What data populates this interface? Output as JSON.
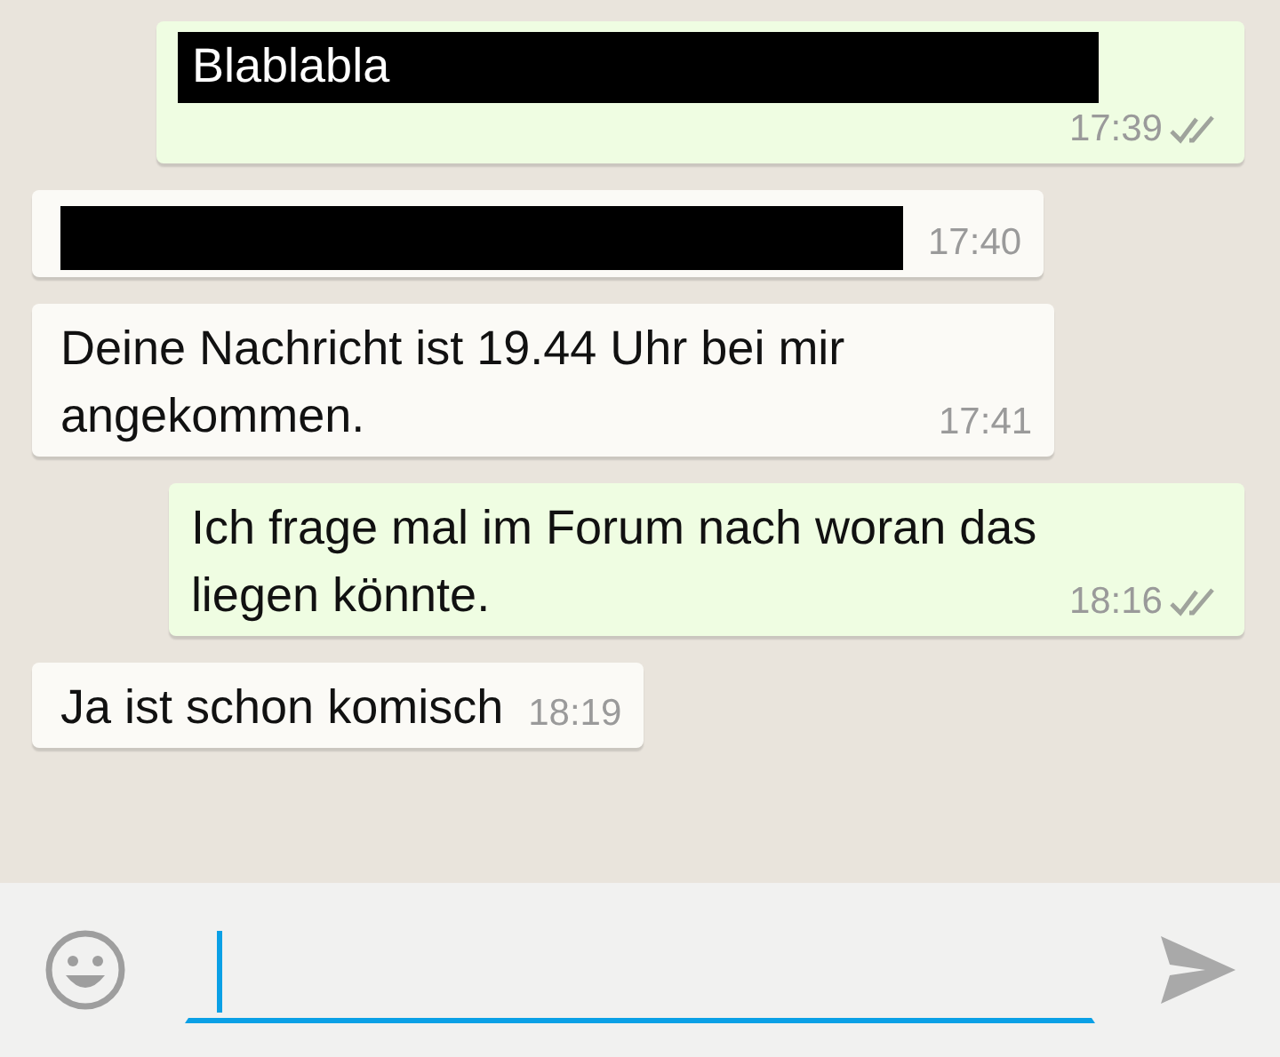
{
  "messages": [
    {
      "kind": "outgoing",
      "text": "Blablabla",
      "redacted": true,
      "time": "17:39"
    },
    {
      "kind": "incoming",
      "redacted": true,
      "time": "17:40"
    },
    {
      "kind": "incoming",
      "text": "Deine Nachricht ist 19.44 Uhr bei mir angekommen.",
      "redacted": false,
      "time": "17:41"
    },
    {
      "kind": "outgoing",
      "text": "Ich frage mal im Forum nach woran das liegen könnte.",
      "redacted": false,
      "time": "18:16"
    },
    {
      "kind": "incoming",
      "text": "Ja ist schon komisch",
      "redacted": false,
      "time": "18:19"
    }
  ],
  "composer": {
    "focused": true
  }
}
